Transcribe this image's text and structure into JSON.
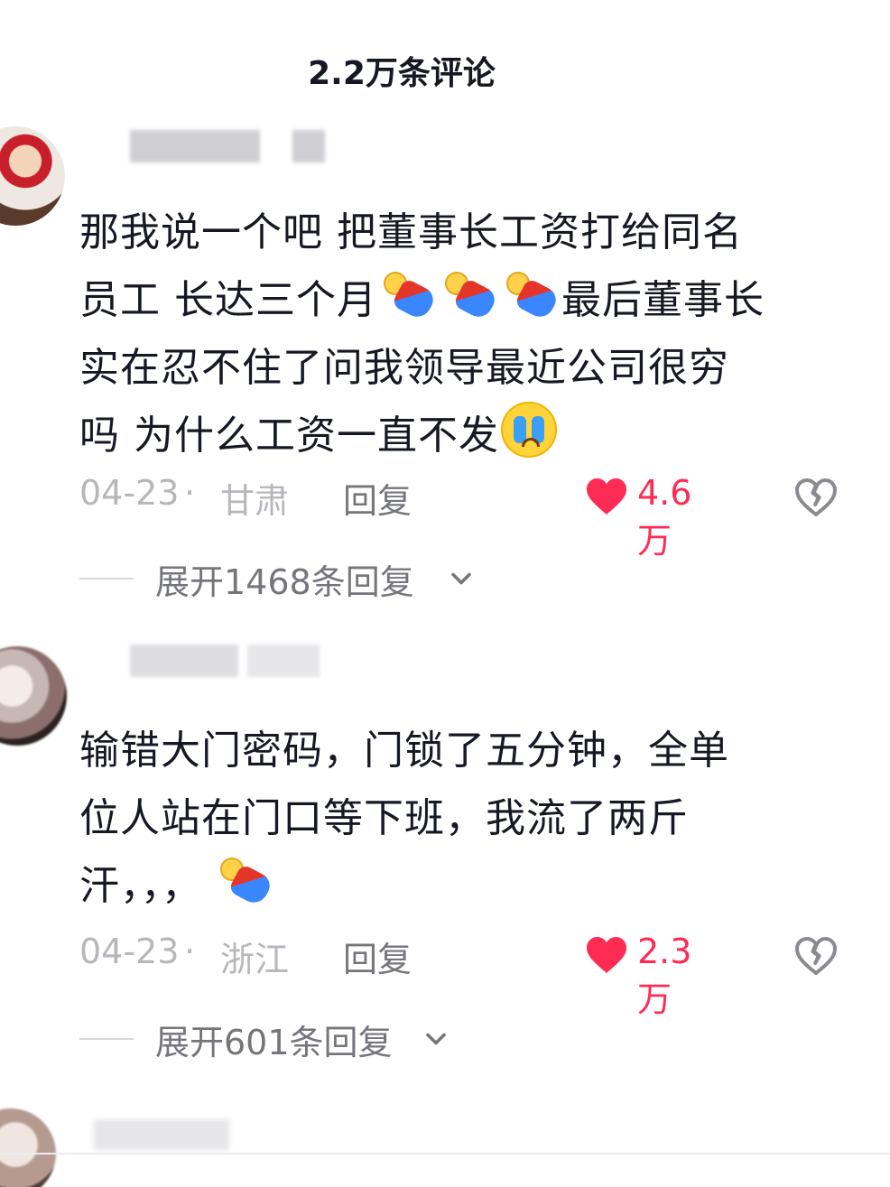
{
  "header": {
    "title": "2.2万条评论"
  },
  "comments": [
    {
      "lines": [
        "那我说一个吧  把董事长工资打给同名",
        "员工  长达三个月",
        "最后董事长",
        "实在忍不住了问我领导最近公司很穷",
        "吗 为什么工资一直不发"
      ],
      "emojis": [
        "lying-doll-emoji",
        "lying-doll-emoji",
        "lying-doll-emoji",
        "crying-face-emoji"
      ],
      "date": "04-23",
      "separator": "·",
      "region": "甘肃",
      "reply_label": "回复",
      "likes": "4.6万",
      "expand_label": "展开1468条回复"
    },
    {
      "lines": [
        "输错大门密码，门锁了五分钟，全单",
        "位人站在门口等下班，我流了两斤",
        "汗，，，"
      ],
      "emojis": [
        "lying-doll-emoji"
      ],
      "date": "04-23",
      "separator": "·",
      "region": "浙江",
      "reply_label": "回复",
      "likes": "2.3万",
      "expand_label": "展开601条回复"
    }
  ],
  "colors": {
    "like": "#fe2c55",
    "text_primary": "#161823",
    "text_secondary": "#b6b7bb",
    "text_action": "#75767c"
  },
  "icons": [
    "heart-icon",
    "broken-heart-icon",
    "chevron-down-icon"
  ]
}
